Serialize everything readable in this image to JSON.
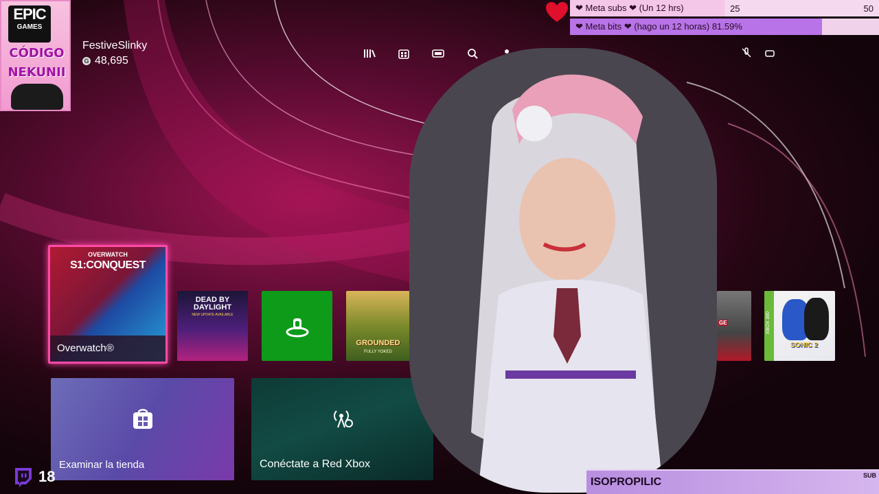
{
  "overlay": {
    "epic_brand": "EPIC",
    "epic_sub": "GAMES",
    "code_line1": "CÓDIGO",
    "code_line2": "NEKUNII"
  },
  "profile": {
    "gamertag": "FestiveSlinky",
    "gamerscore": "48,695",
    "gamerscore_icon": "G"
  },
  "nav": {
    "icons": [
      "library-icon",
      "store-icon",
      "game-pass-icon",
      "search-icon",
      "profile-icon"
    ]
  },
  "goals": {
    "subs": {
      "label": "❤ Meta subs ❤ (Un 12 hrs)",
      "current": "25",
      "target": "50",
      "progress": 0.5
    },
    "bits": {
      "label": "❤ Meta bits ❤ (hago un 12 horas) 81.59%",
      "progress": 0.8159
    }
  },
  "tiles": {
    "overwatch_head": "OVERWATCH",
    "overwatch_season": "S1:CONQUEST",
    "overwatch_label": "Overwatch®",
    "dbd_title": "DEAD BY DAYLIGHT",
    "dbd_subtitle": "NEW UPDATE AVAILABLE",
    "grounded_title": "GROUNDED",
    "grounded_sub": "FULLY YOKED",
    "tile_a_text": "GE",
    "sonic_title": "SONIC 2",
    "sonic_platform": "XBOX 360",
    "store_label": "Examinar la tienda",
    "xnet_label": "Conéctate a Red Xbox"
  },
  "twitch": {
    "viewers": "18"
  },
  "sub_banner": {
    "name": "ISOPROPILIC",
    "tag": "SUB"
  },
  "colors": {
    "accent": "#ff4aa8",
    "background": "#5a0b31",
    "gamepass_green": "#0f9b1a"
  }
}
